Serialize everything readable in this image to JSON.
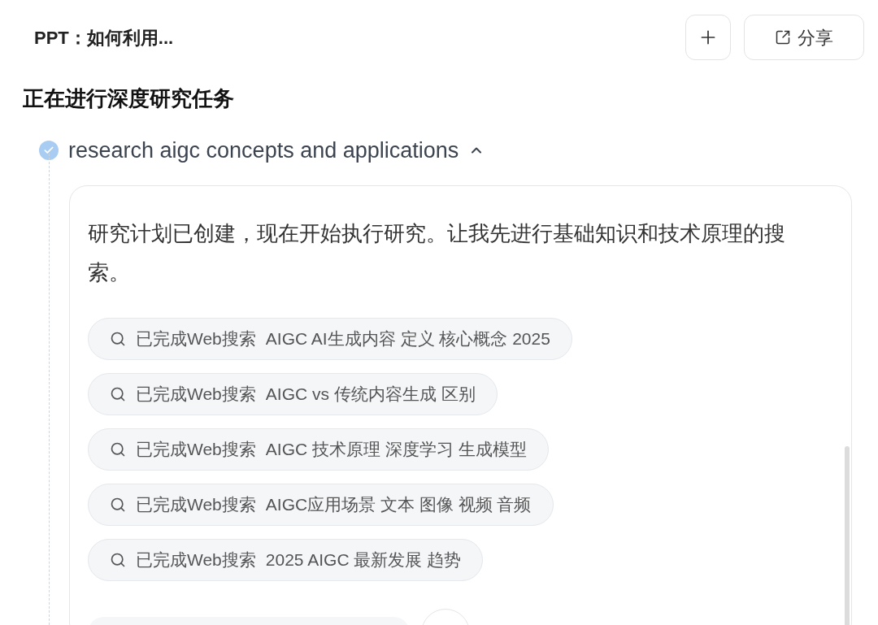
{
  "header": {
    "title": "PPT：如何利用...",
    "share_label": "分享"
  },
  "heading": "正在进行深度研究任务",
  "task": {
    "title": "research aigc concepts and applications",
    "done": true,
    "expanded": true
  },
  "card": {
    "message": "研究计划已创建，现在开始执行研究。让我先进行基础知识和技术原理的搜索。",
    "searches": [
      {
        "status": "已完成Web搜索",
        "query": "AIGC AI生成内容 定义 核心概念 2025"
      },
      {
        "status": "已完成Web搜索",
        "query": "AIGC vs 传统内容生成 区别"
      },
      {
        "status": "已完成Web搜索",
        "query": "AIGC 技术原理 深度学习 生成模型"
      },
      {
        "status": "已完成Web搜索",
        "query": "AIGC应用场景 文本 图像 视频 音频"
      },
      {
        "status": "已完成Web搜索",
        "query": "2025 AIGC 最新发展 趋势"
      }
    ]
  }
}
